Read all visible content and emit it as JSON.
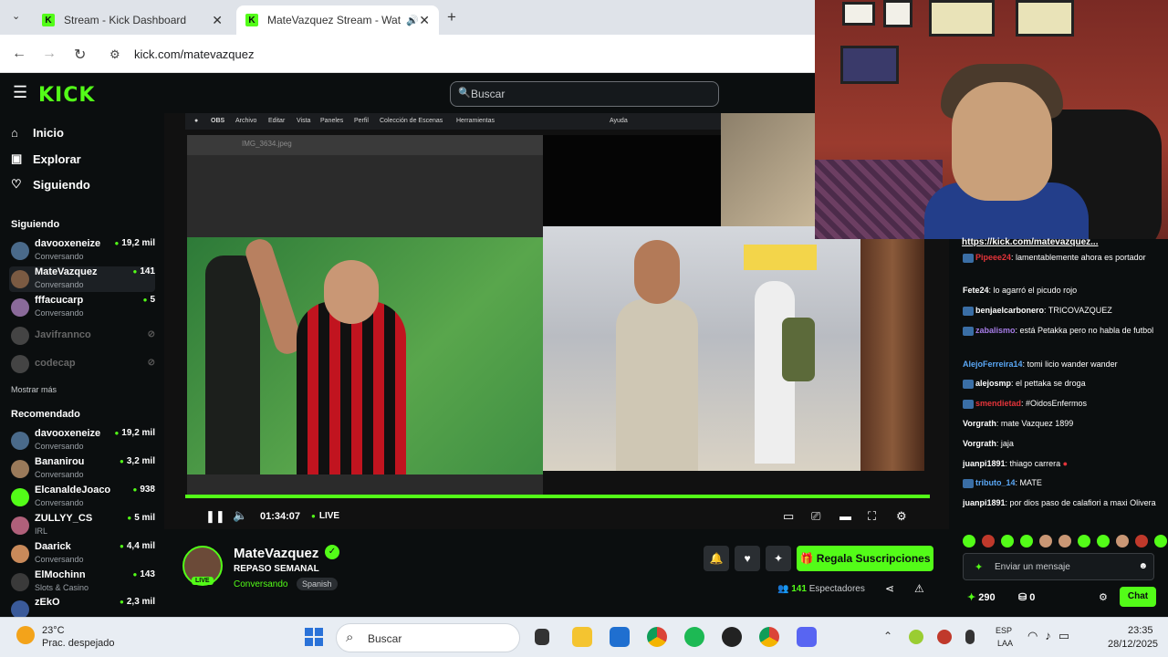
{
  "browser": {
    "tabs": [
      {
        "title": "Stream - Kick Dashboard",
        "close": "✕"
      },
      {
        "title": "MateVazquez Stream - Wat",
        "close": "✕"
      }
    ],
    "new_tab": "+",
    "url": "kick.com/matevazquez"
  },
  "kick": {
    "logo": "KICK",
    "search_placeholder": "Buscar",
    "nav": [
      {
        "label": "Inicio",
        "icon": "home-icon"
      },
      {
        "label": "Explorar",
        "icon": "compass-icon"
      },
      {
        "label": "Siguiendo",
        "icon": "heart-icon"
      }
    ],
    "following_heading": "Siguiendo",
    "following": [
      {
        "name": "davooxeneize",
        "category": "Conversando",
        "count": "19,2 mil"
      },
      {
        "name": "MateVazquez",
        "category": "Conversando",
        "count": "141"
      },
      {
        "name": "fffacucarp",
        "category": "Conversando",
        "count": "5"
      },
      {
        "name": "Javifrannco",
        "category": "",
        "count": ""
      },
      {
        "name": "codecap",
        "category": "",
        "count": ""
      }
    ],
    "show_more": "Mostrar más",
    "recommended_heading": "Recomendado",
    "recommended": [
      {
        "name": "davooxeneize",
        "category": "Conversando",
        "count": "19,2 mil"
      },
      {
        "name": "Bananirou",
        "category": "Conversando",
        "count": "3,2 mil"
      },
      {
        "name": "ElcanaldeJoaco",
        "category": "Conversando",
        "count": "938"
      },
      {
        "name": "ZULLYY_CS",
        "category": "IRL",
        "count": "5 mil"
      },
      {
        "name": "Daarick",
        "category": "Conversando",
        "count": "4,4 mil"
      },
      {
        "name": "ElMochinn",
        "category": "Slots & Casino",
        "count": "143"
      },
      {
        "name": "zEkO",
        "category": "",
        "count": "2,3 mil"
      }
    ]
  },
  "obs": {
    "menu": [
      "OBS",
      "Archivo",
      "Editar",
      "Vista",
      "Paneles",
      "Perfil",
      "Colección de Escenas",
      "Herramientas",
      "Ayuda"
    ],
    "preview_file": "IMG_3634.jpeg"
  },
  "player": {
    "time": "01:34:07",
    "live": "LIVE",
    "progress_fraction": 1.0
  },
  "stream": {
    "name": "MateVazquez",
    "title": "REPASO SEMANAL",
    "category": "Conversando",
    "language": "Spanish",
    "live_badge": "LIVE",
    "subscribe_label": "Regala Suscripciones",
    "viewers_count": "141",
    "viewers_label": "Espectadores"
  },
  "chat": {
    "pinned_link": "https://kick.com/matevazquez...",
    "messages": [
      {
        "user": "Pipeee24",
        "text": "lamentablemente ahora es portador",
        "color": "#e5343a",
        "badge": true
      },
      {
        "user": "Fete24",
        "text": "lo agarró el picudo rojo",
        "color": "#ffffff",
        "badge": false
      },
      {
        "user": "benjaelcarbonero",
        "text": "TRICOVAZQUEZ",
        "color": "#ffffff",
        "badge": true
      },
      {
        "user": "zabalismo",
        "text": "está Petakka pero no habla de futbol",
        "color": "#a77de8",
        "badge": true
      },
      {
        "user": "AlejoFerreira14",
        "text": "tomi licio wander wander",
        "color": "#5aa7f5",
        "badge": false
      },
      {
        "user": "alejosmp",
        "text": "el pettaka se droga",
        "color": "#ffffff",
        "badge": true
      },
      {
        "user": "smendietad",
        "text": "#OidosEnfermos",
        "color": "#e5343a",
        "badge": true
      },
      {
        "user": "Vorgrath",
        "text": "mate Vazquez 1899",
        "color": "#ffffff",
        "badge": false
      },
      {
        "user": "Vorgrath",
        "text": "jaja",
        "color": "#ffffff",
        "badge": false
      },
      {
        "user": "juanpi1891",
        "text": "thiago carrera",
        "color": "#ffffff",
        "badge": false
      },
      {
        "user": "tributo_14",
        "text": "MATE",
        "color": "#5aa7f5",
        "badge": true
      },
      {
        "user": "juanpi1891",
        "text": "por dios paso de calafiori a maxi Olivera",
        "color": "#ffffff",
        "badge": false
      }
    ],
    "input_placeholder": "Enviar un mensaje",
    "points": "290",
    "points2": "0",
    "chat_button": "Chat"
  },
  "taskbar": {
    "temperature": "23°C",
    "weather": "Prac. despejado",
    "search_placeholder": "Buscar",
    "lang1": "ESP",
    "lang2": "LAA",
    "time": "23:35",
    "date": "28/12/2025"
  },
  "colors": {
    "accent": "#53fc18",
    "background": "#0b0e0f"
  }
}
